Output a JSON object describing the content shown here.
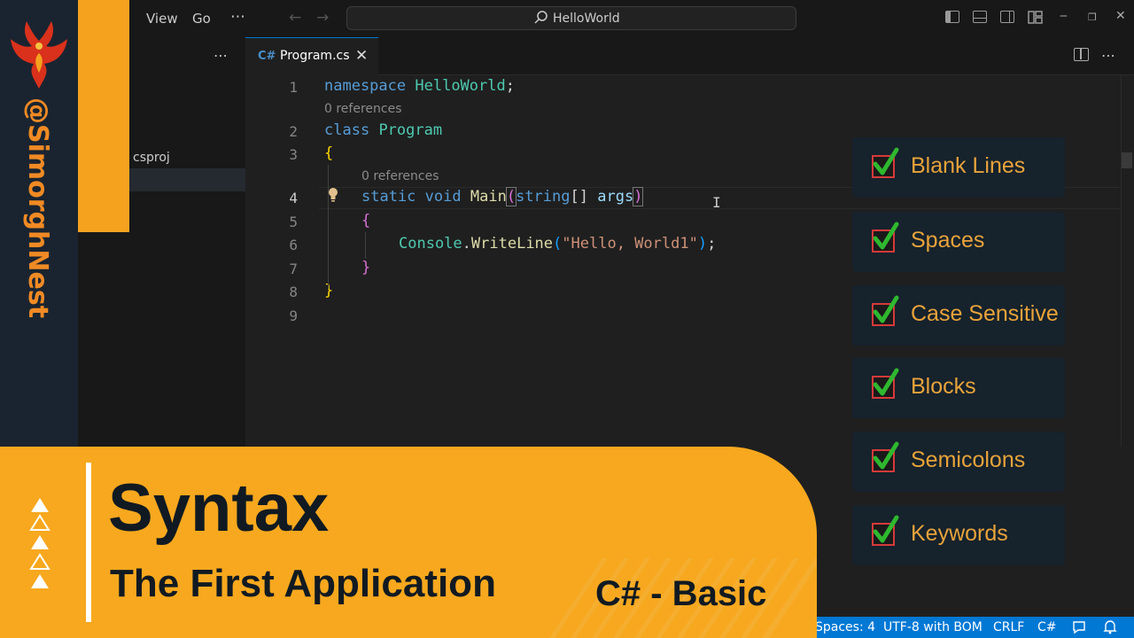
{
  "titlebar": {
    "menu": [
      "View",
      "Go"
    ],
    "more_menu": "⋯",
    "search_text": "HelloWorld"
  },
  "brand": {
    "handle": "@SimorghNest"
  },
  "sidebar": {
    "more": "⋯",
    "file_label": "csproj"
  },
  "tab": {
    "icon_text": "C#",
    "label": "Program.cs",
    "close": "✕"
  },
  "editor": {
    "more": "⋯",
    "line_numbers": [
      "1",
      "2",
      "3",
      "4",
      "5",
      "6",
      "7",
      "8",
      "9"
    ],
    "references_1": "0 references",
    "references_2": "0 references",
    "lines": {
      "l1_kw": "namespace",
      "l1_ns": "HelloWorld",
      "l1_semi": ";",
      "l2_kw": "class",
      "l2_name": "Program",
      "l3": "{",
      "l4_static": "static",
      "l4_void": "void",
      "l4_main": "Main",
      "l4_open": "(",
      "l4_string": "string",
      "l4_arr": "[]",
      "l4_args": "args",
      "l4_close": ")",
      "l5": "{",
      "l6_console": "Console",
      "l6_dot": ".",
      "l6_method": "WriteLine",
      "l6_open": "(",
      "l6_str": "\"Hello, World1\"",
      "l6_close": ")",
      "l6_semi": ";",
      "l7": "}",
      "l8": "}"
    },
    "cursor": "I"
  },
  "checklist": [
    "Blank Lines",
    "Spaces",
    "Case Sensitive",
    "Blocks",
    "Semicolons",
    "Keywords"
  ],
  "statusbar": {
    "spaces": "Spaces: 4",
    "encoding": "UTF-8 with BOM",
    "eol": "CRLF",
    "language": "C#"
  },
  "banner": {
    "title": "Syntax",
    "subtitle": "The First Application",
    "series": "C# - Basic"
  },
  "colors": {
    "accent_blue": "#0078d4",
    "banner_orange": "#f7a81e",
    "checklist_text": "#e8a33a",
    "check_green": "#2fb82f"
  }
}
